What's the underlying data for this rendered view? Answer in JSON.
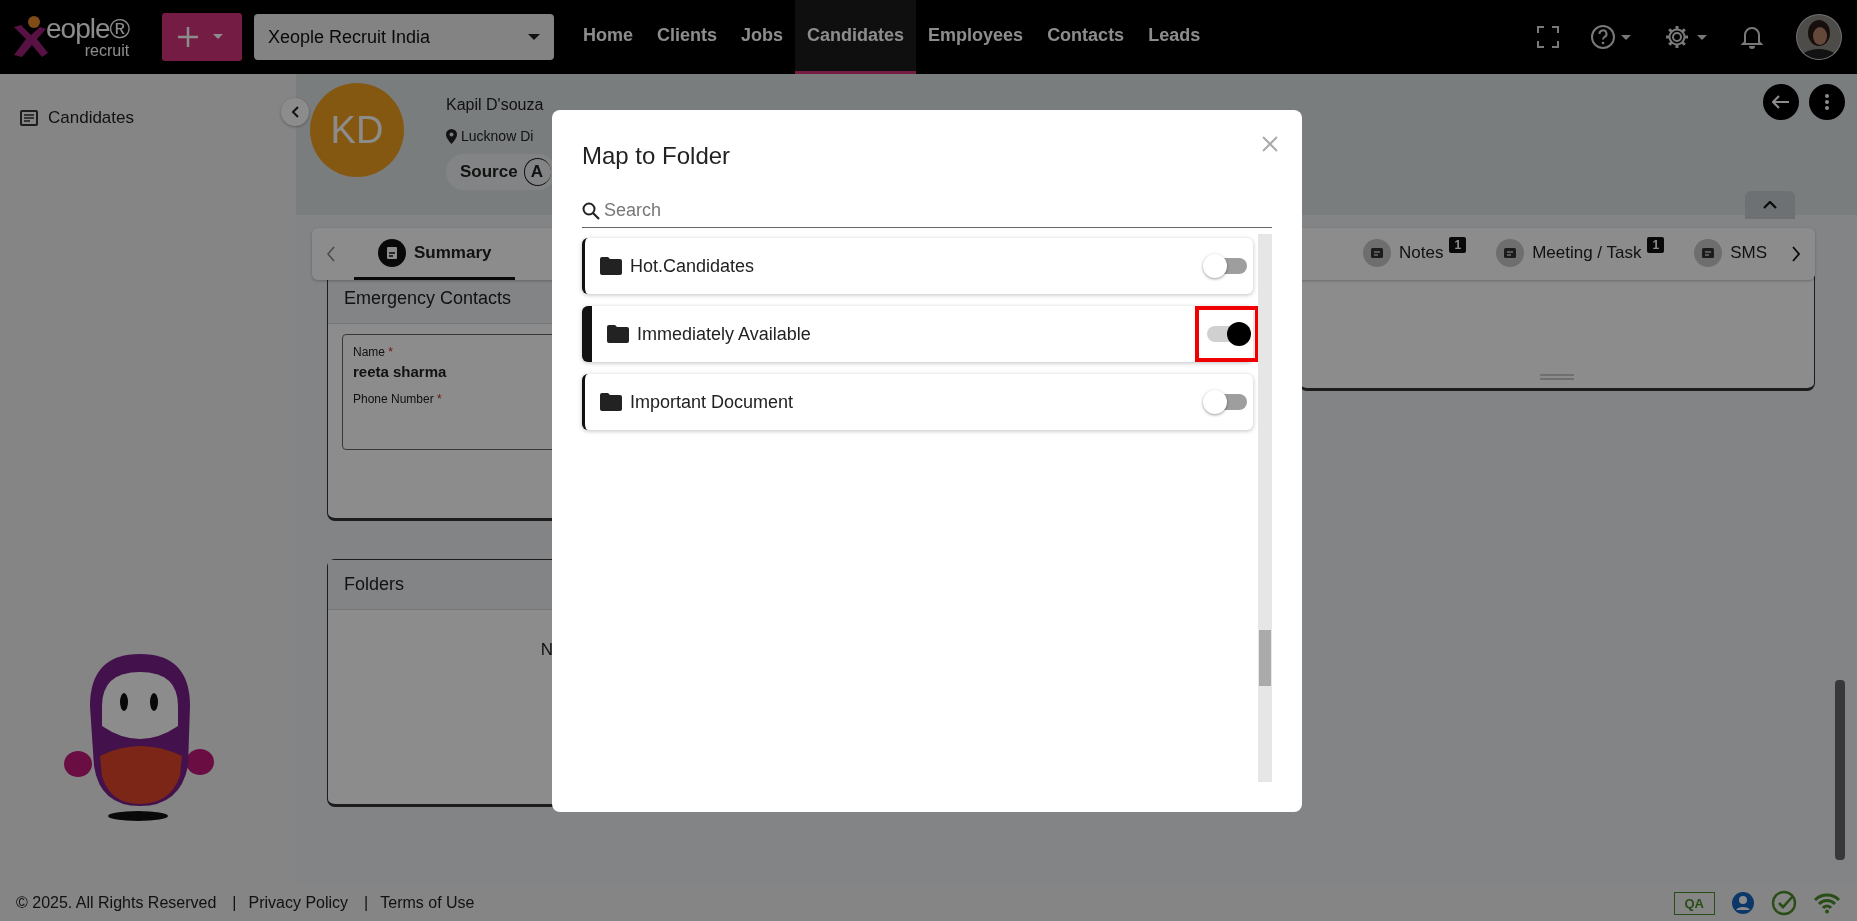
{
  "brand": {
    "wordmark": "eople®",
    "tagline": "recruit"
  },
  "company_select": {
    "value": "Xeople Recruit India"
  },
  "nav": [
    {
      "label": "Home",
      "selected": false
    },
    {
      "label": "Clients",
      "selected": false
    },
    {
      "label": "Jobs",
      "selected": false
    },
    {
      "label": "Candidates",
      "selected": true
    },
    {
      "label": "Employees",
      "selected": false
    },
    {
      "label": "Contacts",
      "selected": false
    },
    {
      "label": "Leads",
      "selected": false
    }
  ],
  "sidebar": {
    "items": [
      {
        "label": "Candidates"
      }
    ]
  },
  "profile": {
    "initials": "KD",
    "name": "Kapil D'souza",
    "location": "Lucknow Di",
    "source_label": "Source",
    "source_value": "A"
  },
  "tabs": [
    {
      "label": "Summary",
      "selected": true
    }
  ],
  "tabs_right": [
    {
      "label": "Notes",
      "badge": "1",
      "selected": false
    },
    {
      "label": "Meeting / Task",
      "badge": "1",
      "selected": false
    },
    {
      "label": "SMS",
      "selected": false
    }
  ],
  "emergency_contacts": {
    "title": "Emergency Contacts",
    "fields": [
      {
        "label": "Name",
        "required_mark": "*",
        "value": "reeta sharma"
      },
      {
        "label": "Phone Number",
        "required_mark": "*"
      }
    ]
  },
  "folders_card": {
    "title": "Folders",
    "empty_text": "N"
  },
  "modal": {
    "title": "Map to Folder",
    "search": {
      "placeholder": "Search"
    },
    "folders": [
      {
        "name": "Hot.Candidates",
        "on": false,
        "highlighted": false
      },
      {
        "name": "Immediately Available",
        "on": true,
        "highlighted": true
      },
      {
        "name": "Important Document",
        "on": false,
        "highlighted": false
      }
    ]
  },
  "footer": {
    "items": [
      {
        "kind": "text",
        "text": "© 2025. All Rights Reserved"
      },
      {
        "kind": "sep",
        "text": "|"
      },
      {
        "kind": "link",
        "text": "Privacy Policy"
      },
      {
        "kind": "sep",
        "text": "|"
      },
      {
        "kind": "link",
        "text": "Terms of Use"
      }
    ],
    "env_badge": "QA"
  }
}
